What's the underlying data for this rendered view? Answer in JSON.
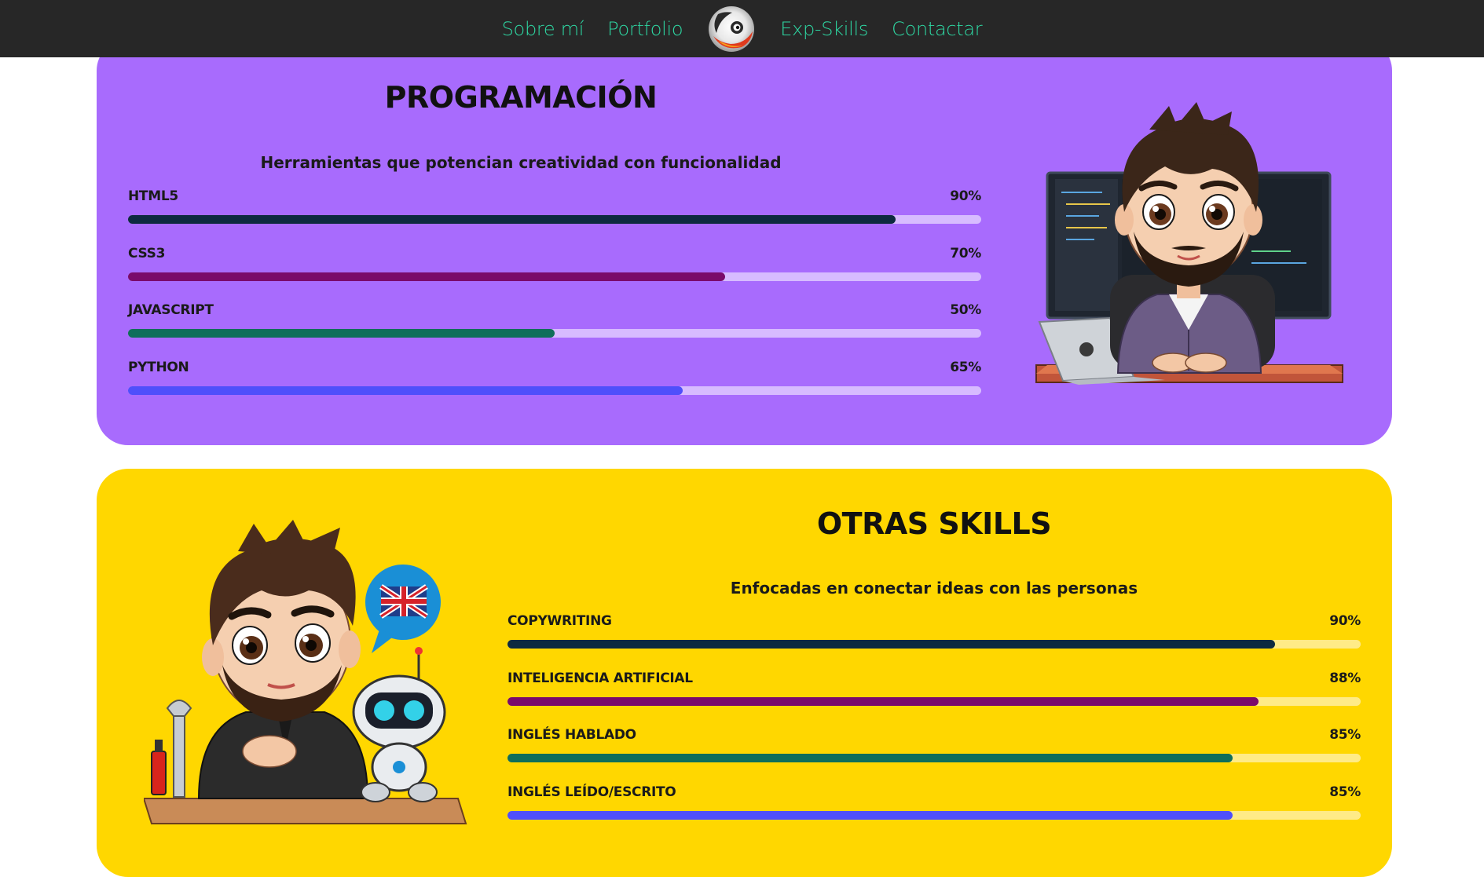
{
  "nav": {
    "items": [
      "Sobre mí",
      "Portfolio",
      "Exp-Skills",
      "Contactar"
    ]
  },
  "colors": {
    "navbar_bg": "#272727",
    "nav_link": "#2ed8a3",
    "prog_bg": "#a86bfd",
    "prog_track": "#d7bbff",
    "other_bg": "#ffd700",
    "other_track": "#ffeb87",
    "bar_navy": "#0d2a40",
    "bar_purple": "#7a0a6b",
    "bar_green": "#0f6e5a",
    "bar_blue": "#4f4ffb"
  },
  "programacion": {
    "title": "PROGRAMACIÓN",
    "subtitle": "Herramientas que potencian creatividad con funcionalidad",
    "skills": [
      {
        "label": "HTML5",
        "percent_text": "90%",
        "value": 90,
        "color": "#0d2a40"
      },
      {
        "label": "CSS3",
        "percent_text": "70%",
        "value": 70,
        "color": "#7a0a6b"
      },
      {
        "label": "JAVASCRIPT",
        "percent_text": "50%",
        "value": 50,
        "color": "#0f6e5a"
      },
      {
        "label": "PYTHON",
        "percent_text": "65%",
        "value": 65,
        "color": "#4f4ffb"
      }
    ],
    "illustration": "developer-avatar-at-desk"
  },
  "otras": {
    "title": "OTRAS SKILLS",
    "subtitle": "Enfocadas en conectar ideas con las personas",
    "skills": [
      {
        "label": "COPYWRITING",
        "percent_text": "90%",
        "value": 90,
        "color": "#0d2a40"
      },
      {
        "label": "INTELIGENCIA ARTIFICIAL",
        "percent_text": "88%",
        "value": 88,
        "color": "#7a0a6b"
      },
      {
        "label": "INGLÉS HABLADO",
        "percent_text": "85%",
        "value": 85,
        "color": "#0f6e5a"
      },
      {
        "label": "INGLÉS LEÍDO/ESCRITO",
        "percent_text": "85%",
        "value": 85,
        "color": "#4f4ffb"
      }
    ],
    "illustration": "avatar-with-robot-and-uk-flag"
  }
}
